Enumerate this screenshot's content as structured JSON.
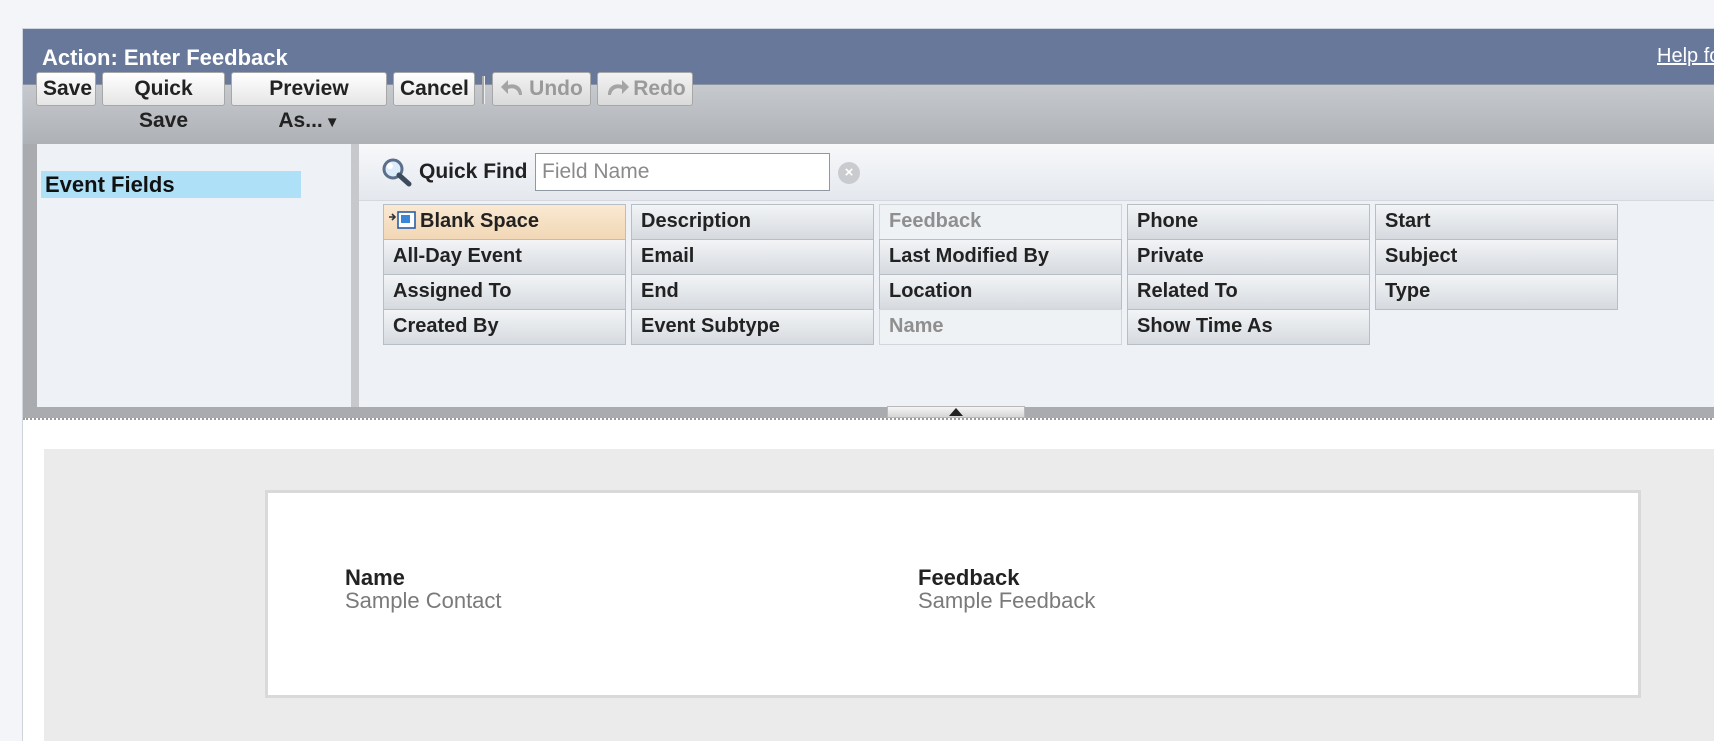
{
  "header": {
    "title": "Action: Enter Feedback",
    "help_link": "Help for this Page"
  },
  "toolbar": {
    "save": "Save",
    "quick_save": "Quick Save",
    "preview_as": "Preview As...",
    "cancel": "Cancel",
    "undo": "Undo",
    "redo": "Redo"
  },
  "sidebar": {
    "items": [
      {
        "label": "Event Fields",
        "selected": true
      }
    ]
  },
  "quick_find": {
    "label": "Quick Find",
    "placeholder": "Field Name",
    "value": ""
  },
  "fields": [
    {
      "label": "Blank Space",
      "used": false
    },
    {
      "label": "All-Day Event",
      "used": false
    },
    {
      "label": "Assigned To",
      "used": false
    },
    {
      "label": "Created By",
      "used": false
    },
    {
      "label": "Description",
      "used": false
    },
    {
      "label": "Email",
      "used": false
    },
    {
      "label": "End",
      "used": false
    },
    {
      "label": "Event Subtype",
      "used": false
    },
    {
      "label": "Feedback",
      "used": true
    },
    {
      "label": "Last Modified By",
      "used": false
    },
    {
      "label": "Location",
      "used": false
    },
    {
      "label": "Name",
      "used": true
    },
    {
      "label": "Phone",
      "used": false
    },
    {
      "label": "Private",
      "used": false
    },
    {
      "label": "Related To",
      "used": false
    },
    {
      "label": "Show Time As",
      "used": false
    },
    {
      "label": "Start",
      "used": false
    },
    {
      "label": "Subject",
      "used": false
    },
    {
      "label": "Type",
      "used": false
    }
  ],
  "layout": {
    "fields": [
      {
        "label": "Name",
        "value": "Sample Contact"
      },
      {
        "label": "Feedback",
        "value": "Sample Feedback"
      }
    ]
  },
  "icons": {
    "quick_find": "magnifier-icon",
    "clear": "clear-x-icon",
    "undo": "undo-arrow-icon",
    "redo": "redo-arrow-icon",
    "blank_space": "blank-space-icon",
    "collapse": "collapse-triangle-icon"
  },
  "colors": {
    "header_bg": "#67789a",
    "selected_sidebar": "#aee0f8",
    "blank_space_bg": "#f1d7b5"
  }
}
